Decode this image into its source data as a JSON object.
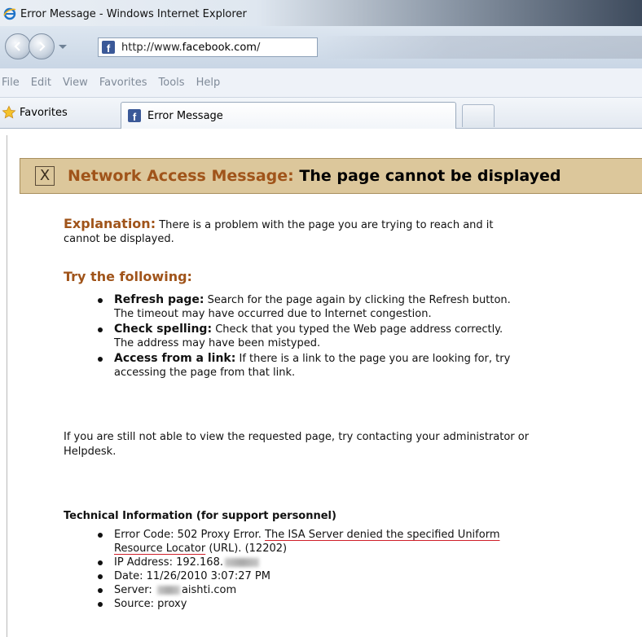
{
  "window": {
    "title": "Error Message - Windows Internet Explorer"
  },
  "navbar": {
    "url_prefix": "http://www.",
    "url_domain": "facebook.com",
    "url_suffix": "/"
  },
  "menu": {
    "items": [
      "File",
      "Edit",
      "View",
      "Favorites",
      "Tools",
      "Help"
    ]
  },
  "favorites_bar": {
    "favorites_label": "Favorites",
    "tab_label": "Error Message"
  },
  "page": {
    "banner_icon": "X",
    "banner_lead": "Network Access Message:",
    "banner_rest": "The page cannot be displayed",
    "explanation_label": "Explanation:",
    "explanation_text": "There is a problem with the page you are trying to reach and it cannot be displayed.",
    "try_heading": "Try the following:",
    "try_items": [
      {
        "label": "Refresh page:",
        "text": "Search for the page again by clicking the Refresh button. The timeout may have occurred due to Internet congestion."
      },
      {
        "label": "Check spelling:",
        "text": "Check that you typed the Web page address correctly. The address may have been mistyped."
      },
      {
        "label": "Access from a link:",
        "text": "If there is a link to the page you are looking for, try accessing the page from that link."
      }
    ],
    "still_text": "If you are still not able to view the requested page, try contacting your administrator or Helpdesk.",
    "tech_heading": "Technical Information (for support personnel)",
    "tech": {
      "error_prefix": "Error Code: 502 Proxy Error.",
      "error_underlined": "The ISA Server denied the specified Uniform Resource Locator",
      "error_suffix": "(URL). (12202)",
      "ip_prefix": "IP Address: 192.168.",
      "date": "Date: 11/26/2010 3:07:27 PM",
      "server_prefix": "Server:",
      "server_suffix": "aishti.com",
      "source": "Source: proxy"
    }
  }
}
